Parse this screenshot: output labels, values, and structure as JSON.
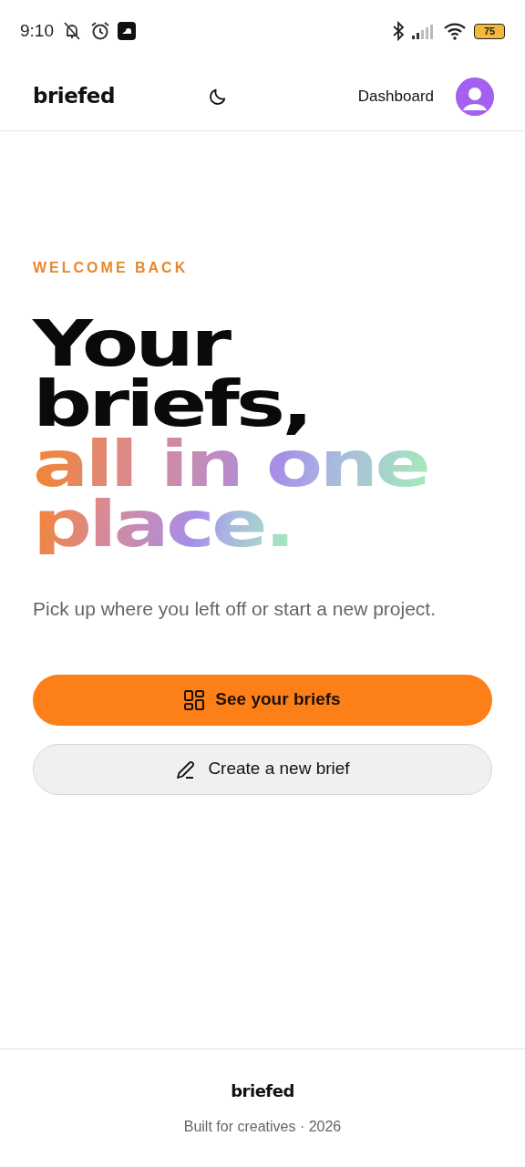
{
  "status_bar": {
    "time": "9:10",
    "battery": "75"
  },
  "navbar": {
    "logo": "briefed",
    "links": [
      {
        "label": "Dashboard"
      }
    ]
  },
  "hero": {
    "eyebrow": "WELCOME BACK",
    "headline": [
      {
        "text": "Your",
        "kind": "plain"
      },
      {
        "text": "briefs,",
        "kind": "plain"
      },
      {
        "text": "all in one",
        "kind": "gradient"
      },
      {
        "text": "place.",
        "kind": "gradient"
      }
    ],
    "subtitle": "Pick up where you left off or start a new project.",
    "buttons": [
      {
        "label": "See your briefs",
        "kind": "primary"
      },
      {
        "label": "Create a new brief",
        "kind": "secondary"
      }
    ]
  },
  "footer": {
    "logo": "briefed",
    "note": "Built for creatives · 2026"
  }
}
